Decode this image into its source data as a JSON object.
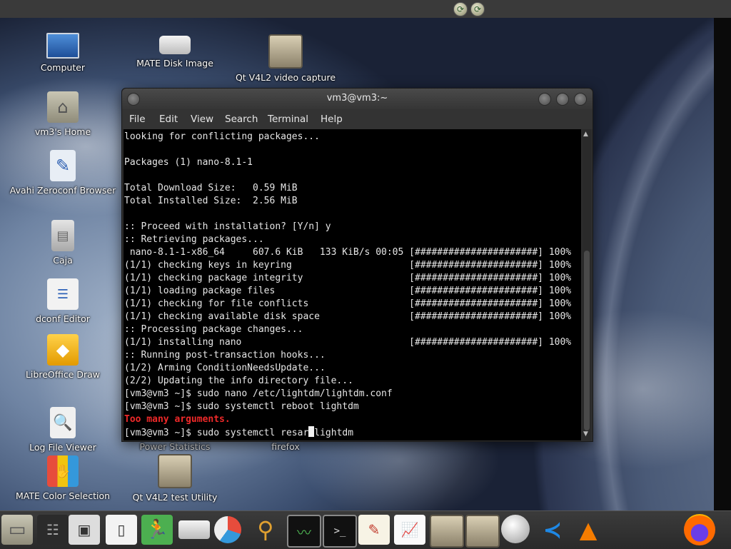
{
  "top_panel": {
    "tray_icons": [
      "tray-update-icon",
      "tray-update-icon"
    ]
  },
  "desktop_icons": [
    {
      "label": "Computer",
      "icon": "computer-icon"
    },
    {
      "label": "vm3's Home",
      "icon": "home-folder-icon"
    },
    {
      "label": "Avahi Zeroconf Browser",
      "icon": "avahi-icon"
    },
    {
      "label": "Caja",
      "icon": "file-cabinet-icon"
    },
    {
      "label": "dconf Editor",
      "icon": "dconf-icon"
    },
    {
      "label": "LibreOffice Draw",
      "icon": "libreoffice-draw-icon"
    },
    {
      "label": "Log File Viewer",
      "icon": "log-viewer-icon"
    },
    {
      "label": "MATE Color Selection",
      "icon": "color-selection-icon"
    },
    {
      "label": "MATE Disk Image",
      "icon": "disk-image-icon"
    },
    {
      "label": "Qt V4L2 video capture",
      "icon": "webcam-icon"
    },
    {
      "label": "Power Statistics",
      "icon": "power-stats-icon"
    },
    {
      "label": "Qt V4L2 test Utility",
      "icon": "webcam-icon"
    },
    {
      "label": "firefox",
      "icon": "firefox-icon"
    }
  ],
  "terminal": {
    "title": "vm3@vm3:~",
    "menu": [
      "File",
      "Edit",
      "View",
      "Search",
      "Terminal",
      "Help"
    ],
    "lines": [
      "looking for conflicting packages...",
      "",
      "Packages (1) nano-8.1-1",
      "",
      "Total Download Size:   0.59 MiB",
      "Total Installed Size:  2.56 MiB",
      "",
      ":: Proceed with installation? [Y/n] y",
      ":: Retrieving packages...",
      " nano-8.1-1-x86_64     607.6 KiB   133 KiB/s 00:05 [######################] 100%",
      "(1/1) checking keys in keyring                     [######################] 100%",
      "(1/1) checking package integrity                   [######################] 100%",
      "(1/1) loading package files                        [######################] 100%",
      "(1/1) checking for file conflicts                  [######################] 100%",
      "(1/1) checking available disk space                [######################] 100%",
      ":: Processing package changes...",
      "(1/1) installing nano                              [######################] 100%",
      ":: Running post-transaction hooks...",
      "(1/2) Arming ConditionNeedsUpdate...",
      "(2/2) Updating the info directory file...",
      "[vm3@vm3 ~]$ sudo nano /etc/lightdm/lightdm.conf",
      "[vm3@vm3 ~]$ sudo systemctl reboot lightdm",
      "Too many arguments."
    ],
    "prompt_before_cursor": "[vm3@vm3 ~]$ sudo systemctl resar",
    "prompt_after_cursor": "lightdm"
  },
  "dock_items": [
    "file-manager-icon",
    "mixer-icon",
    "monitor-icon",
    "phone-icon",
    "exit-icon",
    "disk-icon",
    "disk-usage-icon",
    "search-icon",
    "system-monitor-icon",
    "terminal-icon",
    "text-editor-icon",
    "chart-icon",
    "webcam-icon",
    "webcam-icon",
    "network-icon",
    "vscode-icon",
    "vlc-icon",
    "firefox-icon"
  ]
}
